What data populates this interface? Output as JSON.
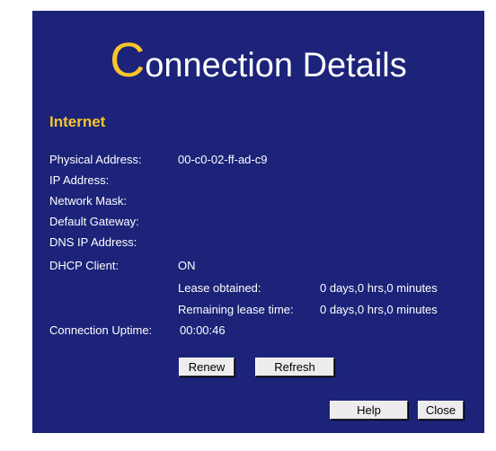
{
  "title": {
    "initial": "C",
    "rest": "onnection Details"
  },
  "section": "Internet",
  "fields": {
    "physical_address": {
      "label": "Physical Address:",
      "value": "00-c0-02-ff-ad-c9"
    },
    "ip_address": {
      "label": "IP Address:"
    },
    "network_mask": {
      "label": "Network Mask:"
    },
    "default_gateway": {
      "label": "Default Gateway:"
    },
    "dns_ip_address": {
      "label": "DNS IP Address:"
    },
    "dhcp_client": {
      "label": "DHCP Client:",
      "value": "ON"
    },
    "lease_obtained": {
      "label": "Lease obtained:",
      "value": "0 days,0 hrs,0 minutes"
    },
    "remaining_lease": {
      "label": "Remaining lease time:",
      "value": "0 days,0 hrs,0 minutes"
    },
    "connection_uptime": {
      "label": "Connection Uptime:",
      "value": "00:00:46"
    }
  },
  "buttons": {
    "renew": "Renew",
    "refresh": "Refresh",
    "help": "Help",
    "close": "Close"
  },
  "colors": {
    "panel_bg": "#1c2379",
    "accent": "#f6c62a",
    "text": "#ffffff",
    "button_bg": "#ededed"
  }
}
